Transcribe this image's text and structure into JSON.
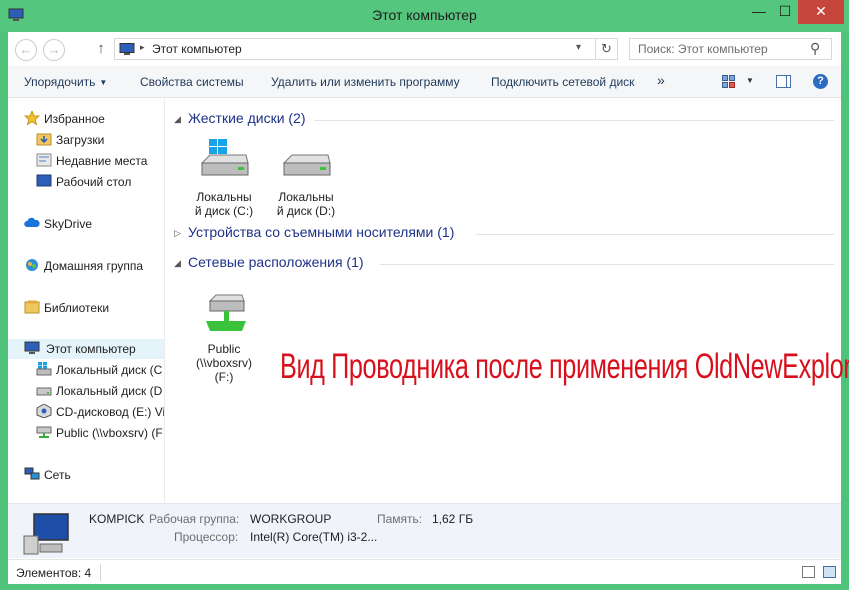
{
  "window": {
    "title": "Этот компьютер",
    "controls": {
      "minimize": "—",
      "maximize": "☐",
      "close": "✕"
    }
  },
  "address_bar": {
    "back": "←",
    "forward": "→",
    "up": "↑",
    "separator": "▸",
    "path": "Этот компьютер",
    "dropdown": "▾",
    "refresh": "↻"
  },
  "search": {
    "placeholder": "Поиск: Этот компьютер",
    "icon": "search-icon",
    "glyph": "⚲"
  },
  "toolbar": {
    "organize": "Упорядочить",
    "organize_caret": "▼",
    "system_properties": "Свойства системы",
    "uninstall": "Удалить или изменить программу",
    "map_drive": "Подключить сетевой диск",
    "more": "»",
    "views_caret": "▼",
    "help": "?"
  },
  "nav_pane": {
    "favorites": {
      "label": "Избранное",
      "items": [
        {
          "label": "Загрузки",
          "icon": "downloads-folder-icon"
        },
        {
          "label": "Недавние места",
          "icon": "recent-places-icon"
        },
        {
          "label": "Рабочий стол",
          "icon": "desktop-icon"
        }
      ]
    },
    "skydrive": "SkyDrive",
    "homegroup": "Домашняя группа",
    "libraries": "Библиотеки",
    "this_pc": {
      "label": "Этот компьютер",
      "items": [
        {
          "label": "Локальный диск (C",
          "icon": "windows-drive-icon"
        },
        {
          "label": "Локальный диск (D",
          "icon": "hard-drive-icon"
        },
        {
          "label": "CD-дисковод (E:) Vi",
          "icon": "cd-drive-icon"
        },
        {
          "label": "Public (\\\\vboxsrv) (F",
          "icon": "network-drive-icon"
        }
      ]
    },
    "network": "Сеть"
  },
  "content": {
    "groups": {
      "hard_disks": {
        "arrow": "◢",
        "title": "Жесткие диски (2)"
      },
      "removable": {
        "arrow": "▷",
        "title": "Устройства со съемными носителями (1)"
      },
      "network": {
        "arrow": "◢",
        "title": "Сетевые расположения (1)"
      }
    },
    "drives": [
      {
        "line1": "Локальны",
        "line2": "й диск (C:)"
      },
      {
        "line1": "Локальны",
        "line2": "й диск (D:)"
      }
    ],
    "network_location": {
      "line1": "Public",
      "line2": "(\\\\vboxsrv)",
      "line3": "(F:)"
    },
    "overlay_caption": "Вид Проводника после применения OldNewExplorer"
  },
  "details": {
    "computer_name": "KOMPICK",
    "workgroup_label": "Рабочая группа:",
    "workgroup": "WORKGROUP",
    "memory_label": "Память:",
    "memory": "1,62 ГБ",
    "processor_label": "Процессор:",
    "processor": "Intel(R) Core(TM) i3-2..."
  },
  "statusbar": {
    "items_count": "Элементов: 4"
  },
  "colors": {
    "titlebar": "#55c67d",
    "close_button": "#c7463c",
    "group_title": "#1e3287",
    "overlay_caption": "#d8101d",
    "selected_nav": "#e5f3fb"
  }
}
